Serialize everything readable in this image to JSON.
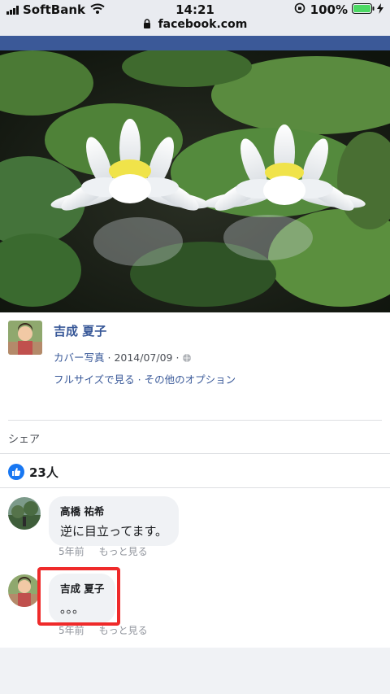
{
  "status_bar": {
    "carrier": "SoftBank",
    "time": "14:21",
    "battery": "100%",
    "url": "facebook.com",
    "icons": [
      "signal-icon",
      "wifi-icon",
      "lock-icon",
      "orientation-lock-icon",
      "battery-icon",
      "charging-icon"
    ]
  },
  "post": {
    "author": "吉成 夏子",
    "album": "カバー写真",
    "date": "2014/07/09",
    "options": [
      "フルサイズで見る",
      "その他のオプション"
    ],
    "share_label": "シェア",
    "like_count": "23人"
  },
  "comments": [
    {
      "name": "高橋 祐希",
      "text": "逆に目立ってます。",
      "time": "5年前",
      "action": "もっと見る"
    },
    {
      "name": "吉成 夏子",
      "text": "。。。",
      "time": "5年前",
      "action": "もっと見る"
    }
  ],
  "colors": {
    "link": "#385898",
    "like": "#1877f2",
    "highlight": "#ef2a2a",
    "fb_blue": "#3b5998"
  }
}
